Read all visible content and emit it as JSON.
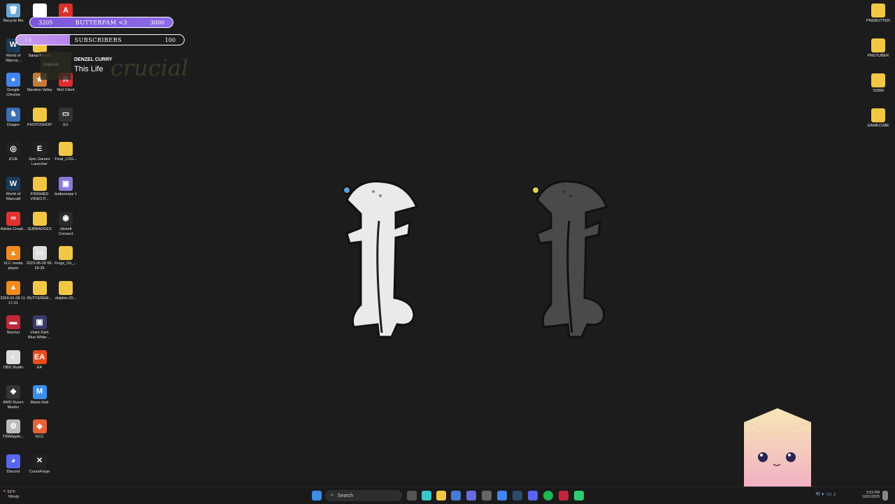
{
  "desktop_left": [
    {
      "label": "Recycle Bin",
      "icon": "recycle-bin-icon",
      "x": 0,
      "y": 0,
      "color": "#6aa7d8",
      "glyph": "🗑"
    },
    {
      "label": "CapCut",
      "icon": "capcut-icon",
      "x": 1,
      "y": 0,
      "color": "#ffffff",
      "glyph": "✂",
      "hide_label": true
    },
    {
      "label": "Adobe",
      "icon": "adobe-icon",
      "x": 2,
      "y": 0,
      "color": "#d9312b",
      "glyph": "A",
      "hide_label": true
    },
    {
      "label": "World of Warcra...",
      "icon": "wow-icon",
      "x": 0,
      "y": 1,
      "color": "#1b3b5a",
      "glyph": "W"
    },
    {
      "label": "Samp Portab",
      "icon": "folder-icon",
      "x": 1,
      "y": 1,
      "color": "#f2c745",
      "glyph": ""
    },
    {
      "label": "Google Chrome",
      "icon": "chrome-icon",
      "x": 0,
      "y": 2,
      "color": "#4285f4",
      "glyph": "●"
    },
    {
      "label": "Stardew Valley",
      "icon": "stardew-icon",
      "x": 1,
      "y": 2,
      "color": "#c07a3a",
      "glyph": "★"
    },
    {
      "label": "Riot Client",
      "icon": "riot-icon",
      "x": 2,
      "y": 2,
      "color": "#e02c2c",
      "glyph": "R"
    },
    {
      "label": "Dragon",
      "icon": "dragon-icon",
      "x": 0,
      "y": 3,
      "color": "#3b6fb6",
      "glyph": "♞"
    },
    {
      "label": "PHOTOSHOP",
      "icon": "folder-icon",
      "x": 1,
      "y": 3,
      "color": "#f2c745",
      "glyph": ""
    },
    {
      "label": "EV",
      "icon": "ev-icon",
      "x": 2,
      "y": 3,
      "color": "#333333",
      "glyph": "▭"
    },
    {
      "label": "iCUE",
      "icon": "icue-icon",
      "x": 0,
      "y": 4,
      "color": "#222222",
      "glyph": "◎"
    },
    {
      "label": "Epic Games Launcher",
      "icon": "epic-icon",
      "x": 1,
      "y": 4,
      "color": "#222222",
      "glyph": "E"
    },
    {
      "label": "Final_LOG...",
      "icon": "folder-icon",
      "x": 2,
      "y": 4,
      "color": "#f2c745",
      "glyph": ""
    },
    {
      "label": "World of Warcraft",
      "icon": "wow-icon",
      "x": 0,
      "y": 5,
      "color": "#1b3b5a",
      "glyph": "W"
    },
    {
      "label": "FINISHED VIDEO P...",
      "icon": "folder-icon",
      "x": 1,
      "y": 5,
      "color": "#f2c745",
      "glyph": ""
    },
    {
      "label": "butteneeps 1",
      "icon": "image-icon",
      "x": 2,
      "y": 5,
      "color": "#8a7ad8",
      "glyph": "▣"
    },
    {
      "label": "Adobe Creati...",
      "icon": "creative-cloud-icon",
      "x": 0,
      "y": 6,
      "color": "#e3322e",
      "glyph": "∞"
    },
    {
      "label": "SUBBADGES",
      "icon": "folder-icon",
      "x": 1,
      "y": 6,
      "color": "#f2c745",
      "glyph": ""
    },
    {
      "label": "Ubisoft Connect",
      "icon": "ubisoft-icon",
      "x": 2,
      "y": 6,
      "color": "#2a2a2a",
      "glyph": "◉"
    },
    {
      "label": "VLC media player",
      "icon": "vlc-icon",
      "x": 0,
      "y": 7,
      "color": "#f08a1c",
      "glyph": "▲"
    },
    {
      "label": "2023-06-09 06-29-35",
      "icon": "video-file-icon",
      "x": 1,
      "y": 7,
      "color": "#dddddd",
      "glyph": "▭"
    },
    {
      "label": "Frogs_On_...",
      "icon": "folder-icon",
      "x": 2,
      "y": 7,
      "color": "#f2c745",
      "glyph": ""
    },
    {
      "label": "2024-01-08 11-17-21",
      "icon": "vlc-icon",
      "x": 0,
      "y": 8,
      "color": "#f08a1c",
      "glyph": "▲"
    },
    {
      "label": "BUTTEREM...",
      "icon": "folder-icon",
      "x": 1,
      "y": 8,
      "color": "#f2c745",
      "glyph": ""
    },
    {
      "label": "dolphin-25...",
      "icon": "folder-icon",
      "x": 2,
      "y": 8,
      "color": "#f2c745",
      "glyph": ""
    },
    {
      "label": "Stacher",
      "icon": "stacher-icon",
      "x": 0,
      "y": 9,
      "color": "#c0283a",
      "glyph": "▬"
    },
    {
      "label": "Violet Dark Blue White ...",
      "icon": "image-icon",
      "x": 1,
      "y": 9,
      "color": "#3a3a6a",
      "glyph": "▣"
    },
    {
      "label": "OBS Studio",
      "icon": "obs-icon",
      "x": 0,
      "y": 10,
      "color": "#dddddd",
      "glyph": "◐"
    },
    {
      "label": "EA",
      "icon": "ea-icon",
      "x": 1,
      "y": 10,
      "color": "#e94b1a",
      "glyph": "EA"
    },
    {
      "label": "AMD Ryzen Master",
      "icon": "amd-icon",
      "x": 0,
      "y": 11,
      "color": "#333333",
      "glyph": "◆"
    },
    {
      "label": "Mavis Hub",
      "icon": "mavis-icon",
      "x": 1,
      "y": 11,
      "color": "#3b8ee8",
      "glyph": "M"
    },
    {
      "label": "TSMApplic...",
      "icon": "gear-icon",
      "x": 0,
      "y": 12,
      "color": "#bbbbbb",
      "glyph": "⚙"
    },
    {
      "label": "GCC",
      "icon": "gcc-icon",
      "x": 1,
      "y": 12,
      "color": "#e8623a",
      "glyph": "◈"
    },
    {
      "label": "Discord",
      "icon": "discord-icon",
      "x": 0,
      "y": 13,
      "color": "#5865f2",
      "glyph": "◕"
    },
    {
      "label": "CurseForge",
      "icon": "curseforge-icon",
      "x": 1,
      "y": 13,
      "color": "#222222",
      "glyph": "✕"
    }
  ],
  "desktop_right": [
    {
      "label": "PNGBUTTER",
      "icon": "folder-icon"
    },
    {
      "label": "PNGTUBER",
      "icon": "folder-icon"
    },
    {
      "label": "SSBM",
      "icon": "folder-icon"
    },
    {
      "label": "GAMECUBE",
      "icon": "folder-icon"
    }
  ],
  "overlay": {
    "goal1": {
      "left": "3205",
      "label": "BUTTERFAM <3",
      "right": "3000"
    },
    "goal2": {
      "left": "18",
      "label": "SUBSCRIBERS",
      "right": "100"
    },
    "now_playing": {
      "artist": "DENZEL CURRY",
      "title": "This Life",
      "art_text": "crucial",
      "art_small": "Imperial"
    }
  },
  "taskbar": {
    "search_placeholder": "Search",
    "weather_temp": "53°F",
    "weather_desc": "Windy",
    "time": "5:53 PM",
    "date": "10/31/2025"
  }
}
